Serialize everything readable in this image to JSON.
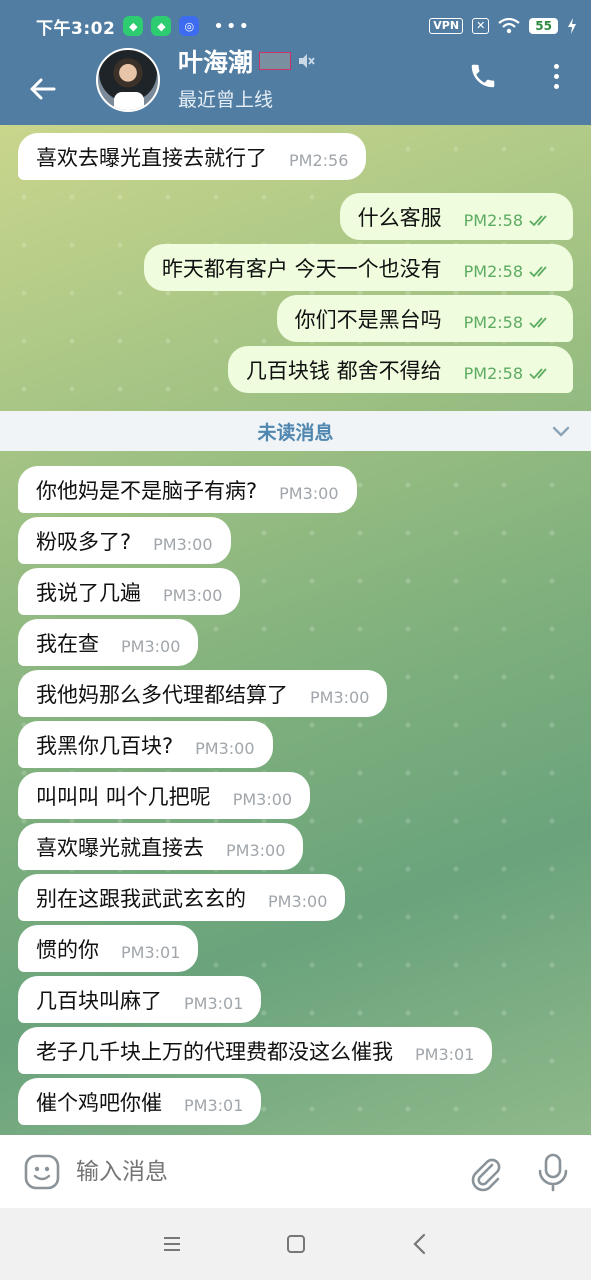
{
  "status": {
    "time": "下午3:02",
    "vpn": "VPN",
    "battery": "55"
  },
  "header": {
    "name": "叶海潮",
    "subtitle": "最近曾上线"
  },
  "divider": {
    "label": "未读消息"
  },
  "messages": [
    {
      "text": "喜欢去曝光直接去就行了",
      "time": "PM2:56"
    },
    {
      "text": "什么客服",
      "time": "PM2:58"
    },
    {
      "text": "昨天都有客户 今天一个也没有",
      "time": "PM2:58"
    },
    {
      "text": "你们不是黑台吗",
      "time": "PM2:58"
    },
    {
      "text": "几百块钱 都舍不得给",
      "time": "PM2:58"
    },
    {
      "text": "你他妈是不是脑子有病?",
      "time": "PM3:00"
    },
    {
      "text": "粉吸多了?",
      "time": "PM3:00"
    },
    {
      "text": "我说了几遍",
      "time": "PM3:00"
    },
    {
      "text": "我在查",
      "time": "PM3:00"
    },
    {
      "text": "我他妈那么多代理都结算了",
      "time": "PM3:00"
    },
    {
      "text": "我黑你几百块?",
      "time": "PM3:00"
    },
    {
      "text": "叫叫叫 叫个几把呢",
      "time": "PM3:00"
    },
    {
      "text": "喜欢曝光就直接去",
      "time": "PM3:00"
    },
    {
      "text": "别在这跟我武武玄玄的",
      "time": "PM3:00"
    },
    {
      "text": "惯的你",
      "time": "PM3:01"
    },
    {
      "text": "几百块叫麻了",
      "time": "PM3:01"
    },
    {
      "text": "老子几千块上万的代理费都没这么催我",
      "time": "PM3:01"
    },
    {
      "text": "催个鸡吧你催",
      "time": "PM3:01"
    }
  ],
  "input": {
    "placeholder": "输入消息"
  },
  "colors": {
    "header": "#517da2",
    "outgoing": "#effdde",
    "incoming": "#ffffff",
    "accent": "#4f87b0"
  }
}
